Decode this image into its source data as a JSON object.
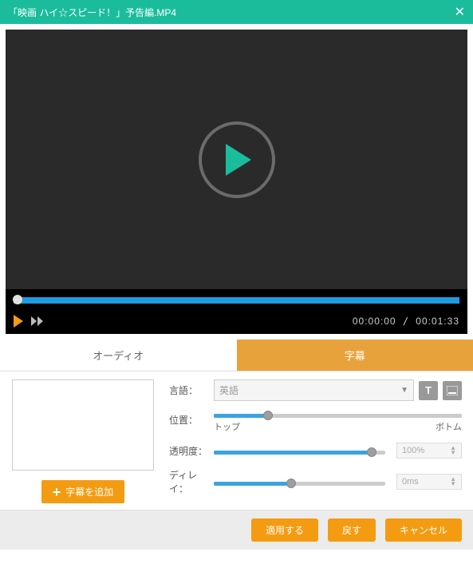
{
  "window": {
    "title": "「映画 ハイ☆スピード！」予告編.MP4"
  },
  "player": {
    "current_time": "00:00:00",
    "total_time": "00:01:33"
  },
  "tabs": {
    "audio": "オーディオ",
    "subtitle": "字幕"
  },
  "add_subtitle_btn": "字幕を追加",
  "labels": {
    "language": "言語：",
    "position": "位置：",
    "opacity": "透明度：",
    "delay": "ディレイ："
  },
  "language_select": "英語",
  "position": {
    "left": "トップ",
    "right": "ボトム"
  },
  "opacity_value": "100%",
  "delay_value": "0ms",
  "footer": {
    "apply": "適用する",
    "back": "戻す",
    "cancel": "キャンセル"
  }
}
